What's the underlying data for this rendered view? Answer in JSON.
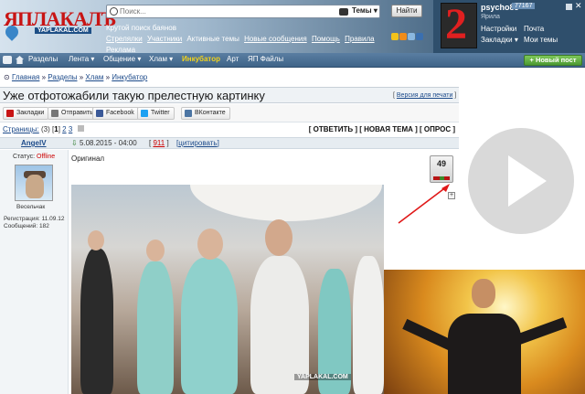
{
  "header": {
    "logo_text": "ЯПЛАКАЛЪ",
    "logo_sub": "YAPLAKAL.COM",
    "search": {
      "placeholder": "Поиск...",
      "scope": "Темы",
      "button": "Найти"
    },
    "links": [
      "Крутой поиск баянов",
      "Стрелялки",
      "Участники",
      "Активные темы",
      "Новые сообщения",
      "Помощь",
      "Правила",
      "Реклама"
    ],
    "icons": [
      "star-icon",
      "rss-icon",
      "tag-icon",
      "bookmark-icon"
    ]
  },
  "user_panel": {
    "username": "psycho83",
    "rep": "77167",
    "role": "Ярила",
    "settings": "Настройки",
    "mail": "Почта",
    "bookmarks": "Закладки",
    "my_topics": "Мои темы",
    "avatar_digit": "2"
  },
  "nav": {
    "items": [
      "Разделы",
      "Лента",
      "Общение",
      "Хлам",
      "Инкубатор",
      "Арт",
      "ЯП Файлы"
    ],
    "highlight": "Инкубатор",
    "new_post": "Новый пост"
  },
  "breadcrumbs": [
    "Главная",
    "Разделы",
    "Хлам",
    "Инкубатор"
  ],
  "topic": {
    "title": "Уже отфотожабили такую прелестную картинку",
    "print_version": "Версия для печати"
  },
  "share": {
    "buttons": [
      {
        "label": "Закладки",
        "color": "#c81414"
      },
      {
        "label": "Отправить",
        "color": "#777777"
      },
      {
        "label": "Facebook",
        "color": "#3b5998"
      },
      {
        "label": "Twitter",
        "color": "#1da1f2"
      },
      {
        "label": "ВКонтакте",
        "color": "#4c75a3"
      }
    ]
  },
  "pages": {
    "label": "Страницы:",
    "count": "(3)",
    "current": "1",
    "others": [
      "2",
      "3"
    ]
  },
  "reply_links": {
    "reply": "ОТВЕТИТЬ",
    "new_topic": "НОВАЯ ТЕМА",
    "poll": "ОПРОС"
  },
  "post": {
    "author": "AngelV",
    "status_label": "Статус:",
    "status": "Offline",
    "rank": "Весельчак",
    "registered": "Регистрация: 11.09.12",
    "messages": "Сообщений: 182",
    "date": "5.08.2015 - 04:00",
    "number": "911",
    "quote": "цитировать",
    "text": "Оригинал",
    "rating": "49",
    "rating_fraction": 0.5,
    "watermark": "YAPLAKAL.COM"
  },
  "colors": {
    "accent": "#1c4a8a",
    "brand": "#c81414",
    "nav": "#4a6f93",
    "new_post": "#5aa83c"
  }
}
